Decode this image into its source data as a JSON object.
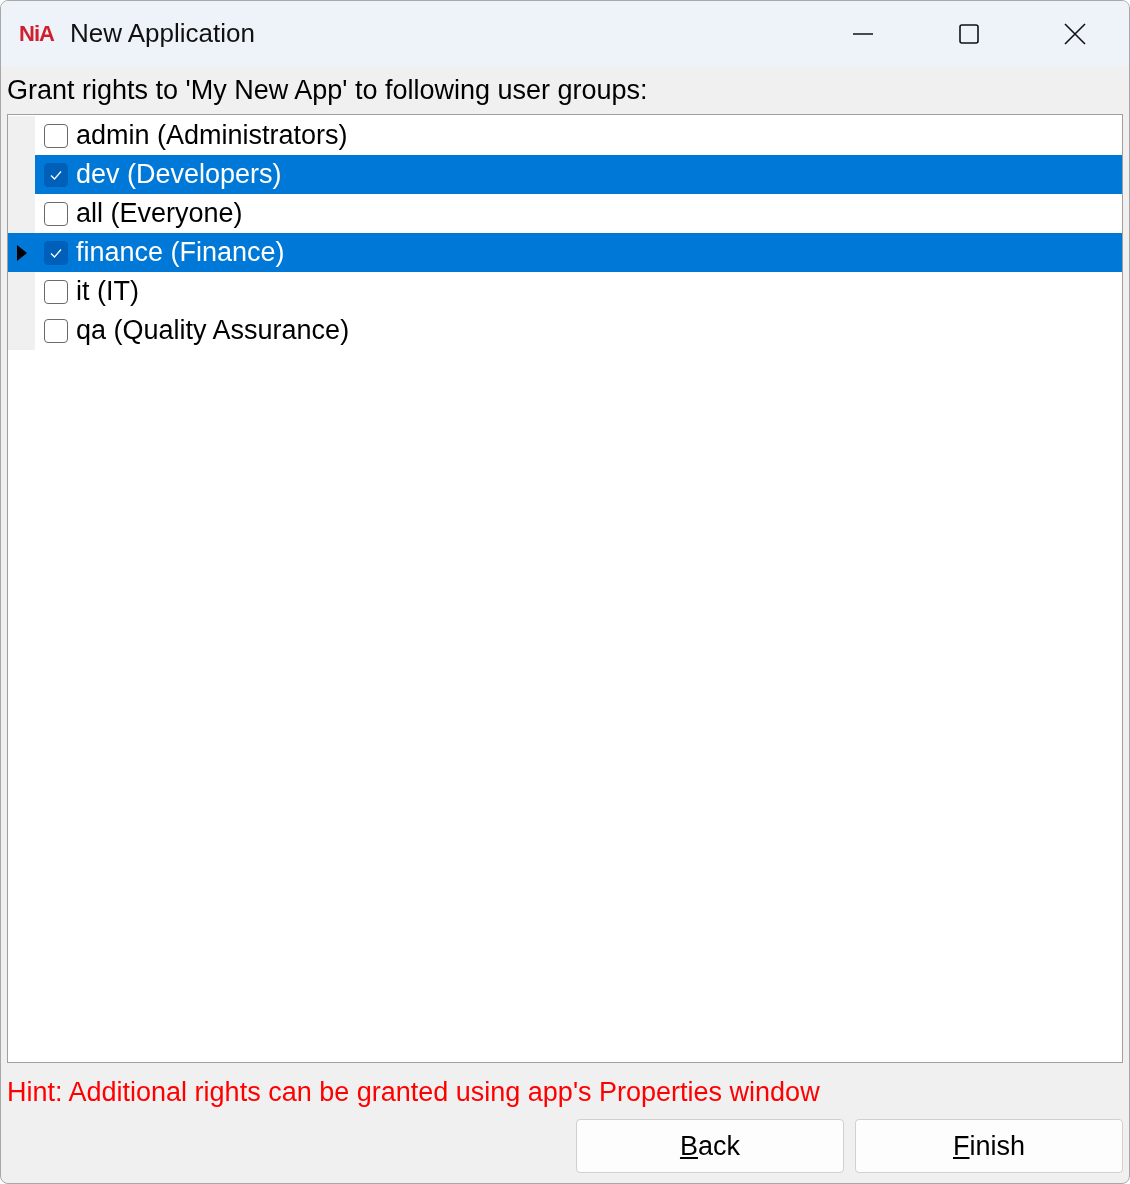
{
  "window": {
    "logo": "NiA",
    "title": "New Application"
  },
  "prompt": "Grant rights to 'My New App' to following user groups:",
  "groups": [
    {
      "label": "admin (Administrators)",
      "checked": false,
      "selected": false,
      "current": false
    },
    {
      "label": "dev (Developers)",
      "checked": true,
      "selected": true,
      "current": false
    },
    {
      "label": "all (Everyone)",
      "checked": false,
      "selected": false,
      "current": false
    },
    {
      "label": "finance (Finance)",
      "checked": true,
      "selected": true,
      "current": true
    },
    {
      "label": "it (IT)",
      "checked": false,
      "selected": false,
      "current": false
    },
    {
      "label": "qa (Quality Assurance)",
      "checked": false,
      "selected": false,
      "current": false
    }
  ],
  "hint": "Hint: Additional rights can be granted using app's Properties window",
  "buttons": [
    {
      "mnemonic": "B",
      "rest": "ack"
    },
    {
      "mnemonic": "F",
      "rest": "inish"
    }
  ]
}
